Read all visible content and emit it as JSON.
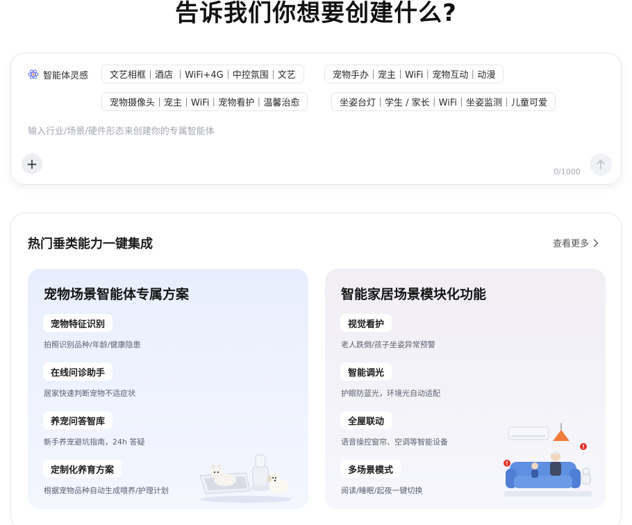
{
  "page": {
    "title": "告诉我们你想要创建什么?"
  },
  "composer": {
    "inspiration_label": "智能体灵感",
    "chips": [
      "文艺相框｜酒店 ｜WiFi+4G｜中控氛围｜文艺",
      "宠物手办｜宠主｜WiFi｜宠物互动｜动漫",
      "宠物摄像头｜宠主｜WiFi｜宠物看护｜温馨治愈",
      "坐姿台灯｜学生 / 家长｜WiFi｜坐姿监测｜儿童可爱"
    ],
    "placeholder": "输入行业/场景/硬件形态来创建你的专属智能体",
    "add_label": "+",
    "counter": "0/1000"
  },
  "section": {
    "title": "热门垂类能力一键集成",
    "more_label": "查看更多",
    "cards": [
      {
        "title": "宠物场景智能体专属方案",
        "features": [
          {
            "tag": "宠物特征识别",
            "desc": "拍照识别品种/年龄/健康隐患"
          },
          {
            "tag": "在线问诊助手",
            "desc": "居家快速判断宠物不适症状"
          },
          {
            "tag": "养宠问答智库",
            "desc": "新手养宠避坑指南，24h 答疑"
          },
          {
            "tag": "定制化养育方案",
            "desc": "根据宠物品种自动生成喂养/护理计划"
          }
        ]
      },
      {
        "title": "智能家居场景模块化功能",
        "features": [
          {
            "tag": "视觉看护",
            "desc": "老人跌倒/孩子坐姿异常预警"
          },
          {
            "tag": "智能调光",
            "desc": "护眼防蓝光，环境光自动适配"
          },
          {
            "tag": "全屋联动",
            "desc": "语音操控窗帘、空调等智能设备"
          },
          {
            "tag": "多场景模式",
            "desc": "阅读/睡眠/起夜一键切换"
          }
        ]
      }
    ]
  },
  "colors": {
    "alert_red": "#e8332a",
    "lamp_orange": "#f07a3c",
    "sofa_blue": "#5f8fe0"
  }
}
